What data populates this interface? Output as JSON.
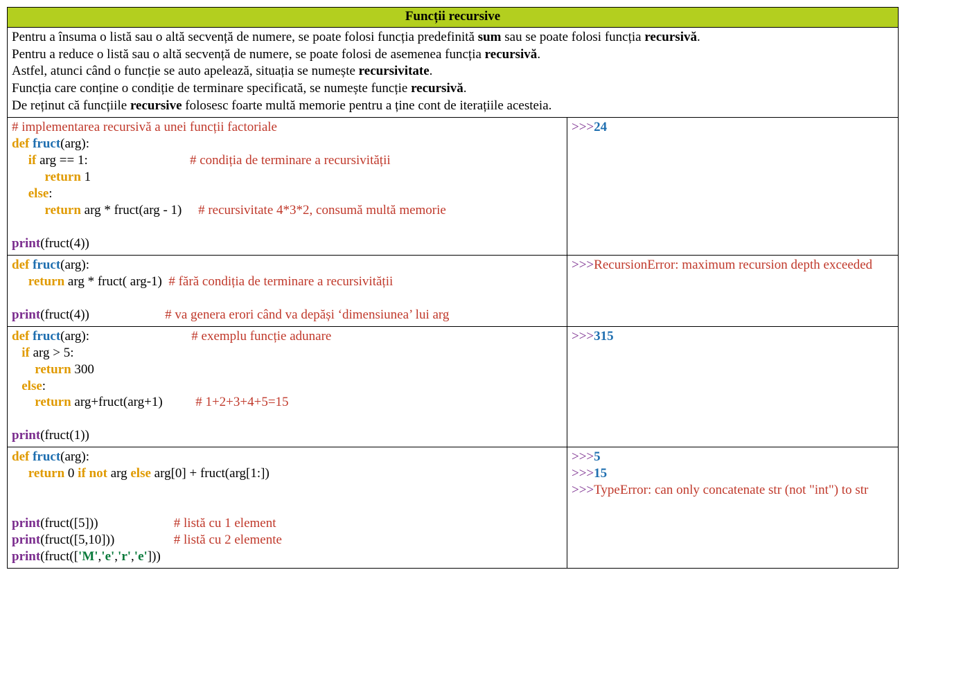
{
  "title": "Funcții recursive",
  "intro": {
    "l1a": "Pentru a însuma o listă sau o altă secvență de numere, se poate folosi funcția predefinită ",
    "l1b": "sum",
    "l1c": " sau se poate folosi funcția ",
    "l1d": "recursivă",
    "l1e": ".",
    "l2a": "Pentru a reduce o listă sau o altă secvență de numere, se poate folosi de asemenea funcția ",
    "l2b": "recursivă",
    "l2c": ".",
    "l3a": "Astfel, atunci când o funcție se auto apelează, situația se numește ",
    "l3b": "recursivitate",
    "l3c": ".",
    "l4a": "Funcția care conține o condiție de terminare specificată, se numește funcție ",
    "l4b": "recursivă",
    "l4c": ".",
    "l5a": "De reținut că funcțiile ",
    "l5b": "recursive",
    "l5c": " folosesc foarte multă memorie pentru a ține cont de iterațiile acesteia."
  },
  "t": {
    "def": "def",
    "fruct": "fruct",
    "arg": "arg",
    "print": "print",
    "if": "if",
    "else": "else",
    "return": "return",
    "not": "not",
    "prompt": ">>>"
  },
  "ex1": {
    "c0": "# implementarea recursivă a unei funcții factoriale",
    "cond": " arg == 1:                               ",
    "c1": "# condiția de terminare a recursivității",
    "ret1": " 1",
    "ret2a": " arg * fruct(arg - 1)     ",
    "c2": "# recursivitate 4*3*2, consumă multă memorie",
    "call": "(fruct(4))",
    "out": "24"
  },
  "ex2": {
    "ret": " arg * fruct( arg-1)  ",
    "c1": "# fără condiția de terminare a recursivității",
    "call": "(fruct(4))                       ",
    "c2": "# va genera erori când va depăși ‘dimensiunea’ lui arg",
    "out": "RecursionError: maximum recursion depth exceeded"
  },
  "ex3": {
    "sigpad": "(arg):                               ",
    "c0": "# exemplu funcție adunare",
    "cond": " arg > 5:",
    "ret1": " 300",
    "ret2a": " arg+fruct(arg+1)          ",
    "c2": "# 1+2+3+4+5=15",
    "call": "(fruct(1))",
    "out": "315"
  },
  "ex4": {
    "ret_a": " 0 ",
    "ret_b": " arg ",
    "ret_c": " arg[0] + fruct(arg[1:])",
    "p1": "(fruct([5]))                       ",
    "c1": "# listă cu 1 element",
    "p2": "(fruct([5,10]))                  ",
    "c2": "# listă cu 2 elemente",
    "p3a": "(fruct([",
    "s_M": "'M'",
    "s_e": "'e'",
    "s_r": "'r'",
    "p3b": "]))",
    "out1": "5",
    "out2": "15",
    "out3": "TypeError: can only concatenate str (not \"int\") to str"
  }
}
